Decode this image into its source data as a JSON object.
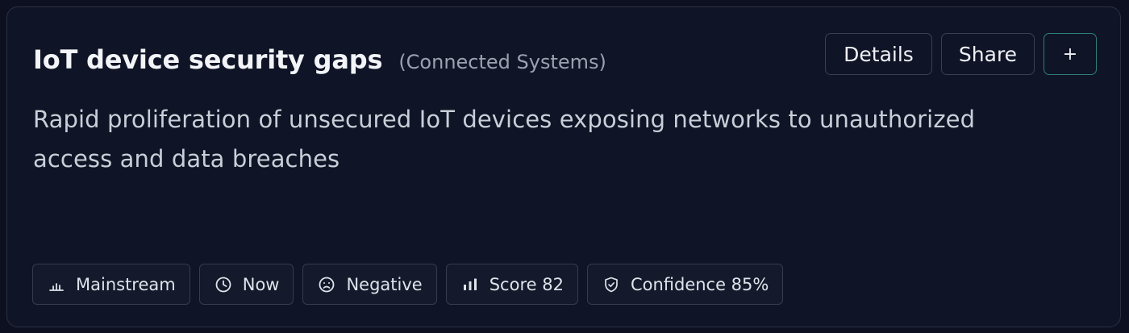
{
  "card": {
    "title": "IoT device security gaps",
    "category": "(Connected Systems)",
    "description": "Rapid proliferation of unsecured IoT devices exposing networks to unauthorized access and data breaches",
    "actions": {
      "details_label": "Details",
      "share_label": "Share",
      "add_label": "+"
    },
    "tags": [
      {
        "icon": "bar-chart-icon",
        "label": "Mainstream"
      },
      {
        "icon": "clock-icon",
        "label": "Now"
      },
      {
        "icon": "frown-face-icon",
        "label": "Negative"
      },
      {
        "icon": "signal-bars-icon",
        "label": "Score 82"
      },
      {
        "icon": "shield-icon",
        "label": "Confidence 85%"
      }
    ]
  },
  "colors": {
    "background": "#0d1020",
    "card_background": "#0f1426",
    "add_button_border": "#2e8077",
    "title_text": "#f2f4f8",
    "muted_text": "#9aa1b0"
  }
}
